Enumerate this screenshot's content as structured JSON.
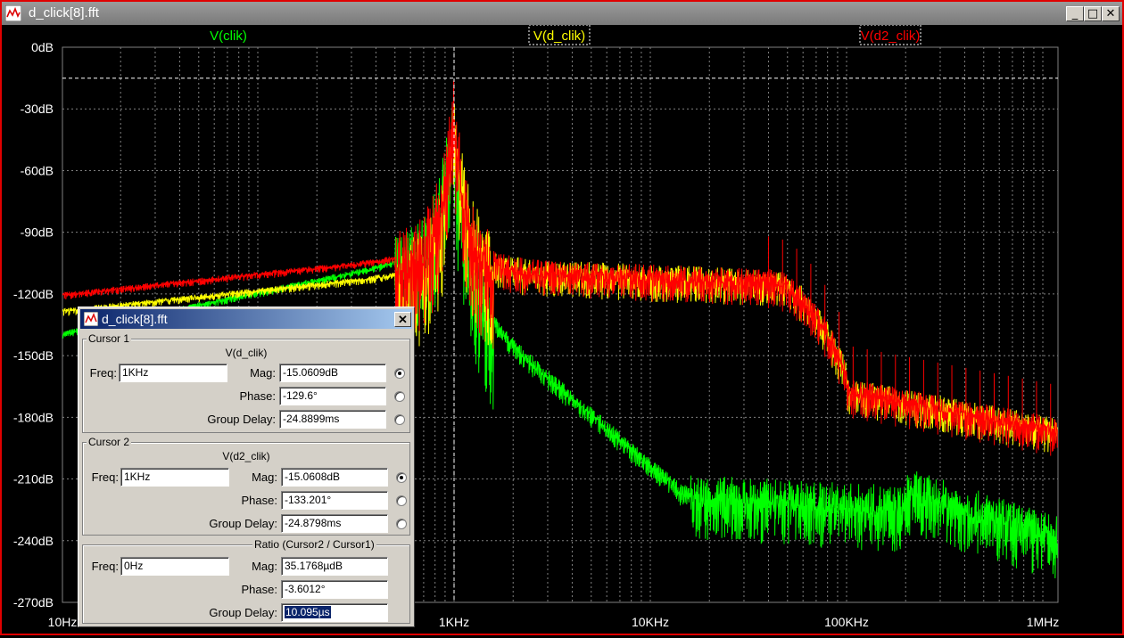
{
  "window": {
    "title": "d_click[8].fft",
    "buttons": {
      "minimize": "_",
      "maximize": "□",
      "close": "✕"
    }
  },
  "plot": {
    "traces": [
      {
        "name": "V(clik)",
        "color": "#00ff00"
      },
      {
        "name": "V(d_clik)",
        "color": "#ffff00"
      },
      {
        "name": "V(d2_clik)",
        "color": "#ff0000"
      }
    ],
    "y_ticks": [
      "0dB",
      "-30dB",
      "-60dB",
      "-90dB",
      "-120dB",
      "-150dB",
      "-180dB",
      "-210dB",
      "-240dB",
      "-270dB"
    ],
    "x_ticks": [
      "10Hz",
      "1KHz",
      "10KHz",
      "100KHz",
      "1MHz"
    ],
    "grid_color": "#808080",
    "background": "#000000"
  },
  "dialog": {
    "title": "d_click[8].fft",
    "close": "✕",
    "cursor1": {
      "group_label": "Cursor 1",
      "signal": "V(d_clik)",
      "freq_label": "Freq:",
      "freq": "1KHz",
      "mag_label": "Mag:",
      "mag": "-15.0609dB",
      "phase_label": "Phase:",
      "phase": "-129.6°",
      "gd_label": "Group Delay:",
      "group_delay": "-24.8899ms"
    },
    "cursor2": {
      "group_label": "Cursor 2",
      "signal": "V(d2_clik)",
      "freq_label": "Freq:",
      "freq": "1KHz",
      "mag_label": "Mag:",
      "mag": "-15.0608dB",
      "phase_label": "Phase:",
      "phase": "-133.201°",
      "gd_label": "Group Delay:",
      "group_delay": "-24.8798ms"
    },
    "ratio": {
      "group_label": "Ratio (Cursor2 / Cursor1)",
      "freq_label": "Freq:",
      "freq": "0Hz",
      "mag_label": "Mag:",
      "mag": "35.1768µdB",
      "phase_label": "Phase:",
      "phase": "-3.6012°",
      "gd_label": "Group Delay:",
      "group_delay": "10.095µs"
    }
  }
}
